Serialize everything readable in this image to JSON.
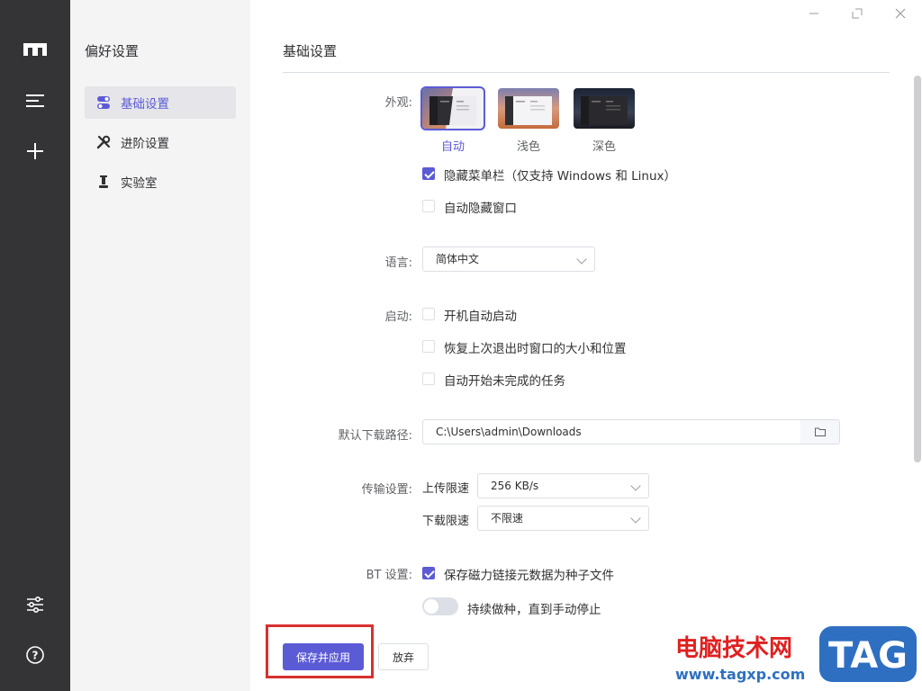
{
  "sidebar": {
    "title": "偏好设置",
    "items": [
      {
        "label": "基础设置",
        "icon": "toggle-icon",
        "active": true
      },
      {
        "label": "进阶设置",
        "icon": "tools-icon",
        "active": false
      },
      {
        "label": "实验室",
        "icon": "lab-icon",
        "active": false
      }
    ]
  },
  "rail": {
    "icons": [
      "logo-icon",
      "menu-icon",
      "add-icon",
      "sliders-icon",
      "help-icon"
    ]
  },
  "window": {
    "controls": [
      "minimize-icon",
      "maximize-icon",
      "close-icon"
    ]
  },
  "main": {
    "title": "基础设置",
    "appearance": {
      "label": "外观:",
      "themes": [
        {
          "label": "自动",
          "selected": true
        },
        {
          "label": "浅色",
          "selected": false
        },
        {
          "label": "深色",
          "selected": false
        }
      ],
      "hide_menu": {
        "label": "隐藏菜单栏（仅支持 Windows 和 Linux）",
        "checked": true
      },
      "auto_hide": {
        "label": "自动隐藏窗口",
        "checked": false
      }
    },
    "language": {
      "label": "语言:",
      "value": "简体中文"
    },
    "startup": {
      "label": "启动:",
      "options": [
        {
          "label": "开机自动启动",
          "checked": false
        },
        {
          "label": "恢复上次退出时窗口的大小和位置",
          "checked": false
        },
        {
          "label": "自动开始未完成的任务",
          "checked": false
        }
      ]
    },
    "download_path": {
      "label": "默认下载路径:",
      "value": "C:\\Users\\admin\\Downloads"
    },
    "transfer": {
      "label": "传输设置:",
      "upload_label": "上传限速",
      "upload_value": "256 KB/s",
      "download_label": "下载限速",
      "download_value": "不限速"
    },
    "bt": {
      "label": "BT 设置:",
      "save_magnet": {
        "label": "保存磁力链接元数据为种子文件",
        "checked": true
      },
      "keep_seeding": {
        "label": "持续做种，直到手动停止",
        "on": false
      }
    },
    "buttons": {
      "save": "保存并应用",
      "discard": "放弃"
    }
  },
  "watermark": {
    "text": "电脑技术网",
    "url": "www.tagxp.com",
    "tag": "TAG"
  },
  "colors": {
    "accent": "#5b5bd6",
    "rail": "#343436",
    "sidebar": "#f4f4f5",
    "highlight": "#d8302f"
  }
}
